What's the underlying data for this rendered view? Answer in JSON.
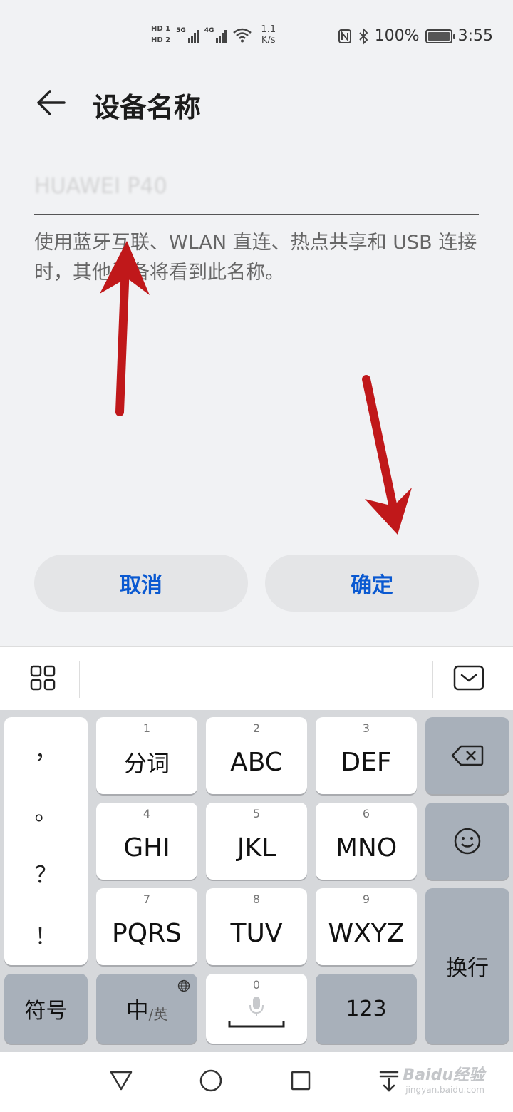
{
  "status_bar": {
    "sim1": "HD 1",
    "sim2": "HD 2",
    "net1": "5G",
    "net2": "4G",
    "speed_value": "1.1",
    "speed_unit": "K/s",
    "battery": "100%",
    "battery_level": 1.0,
    "time": "3:55"
  },
  "header": {
    "title": "设备名称"
  },
  "name_field": {
    "value": "HUAWEI P40"
  },
  "hint": "使用蓝牙互联、WLAN 直连、热点共享和 USB 连接时，其他设备将看到此名称。",
  "buttons": {
    "cancel": "取消",
    "confirm": "确定"
  },
  "keyboard": {
    "punctuation": [
      "，",
      "。",
      "？",
      "！"
    ],
    "keys": [
      {
        "num": "1",
        "label": "分词"
      },
      {
        "num": "2",
        "label": "ABC"
      },
      {
        "num": "3",
        "label": "DEF"
      },
      {
        "num": "4",
        "label": "GHI"
      },
      {
        "num": "5",
        "label": "JKL"
      },
      {
        "num": "6",
        "label": "MNO"
      },
      {
        "num": "7",
        "label": "PQRS"
      },
      {
        "num": "8",
        "label": "TUV"
      },
      {
        "num": "9",
        "label": "WXYZ"
      }
    ],
    "symbols": "符号",
    "lang_main": "中",
    "lang_sub": "/英",
    "space_num": "0",
    "num_mode": "123",
    "enter": "换行"
  },
  "watermark": {
    "main": "Baidu经验",
    "sub": "jingyan.baidu.com"
  },
  "colors": {
    "accent": "#0a59d1",
    "annotation": "#c0181a",
    "background": "#f1f2f4"
  }
}
